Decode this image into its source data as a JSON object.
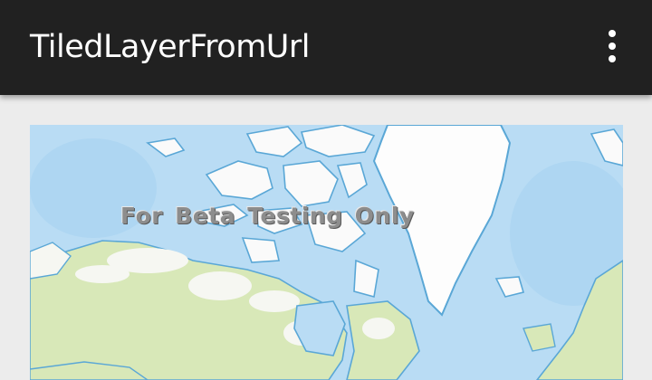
{
  "app_bar": {
    "title": "TiledLayerFromUrl",
    "overflow_icon": "more-vert-icon",
    "background": "#212121"
  },
  "map": {
    "watermark": "For  Beta  Testing  Only",
    "colors": {
      "ocean": "#b9dcf4",
      "deep_ocean": "#a6d1f0",
      "ice": "#fbfbfb",
      "vegetation": "#d6e6b4",
      "coast": "#5aa7d6"
    }
  }
}
